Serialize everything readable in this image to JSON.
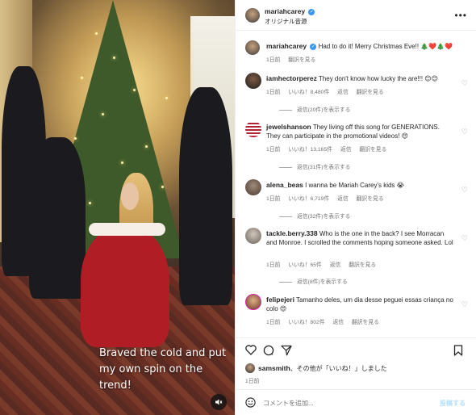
{
  "post": {
    "caption_video": "Braved the cold and put my own spin on the trend!"
  },
  "header": {
    "username": "mariahcarey",
    "audio": "オリジナル音源",
    "more": "•••"
  },
  "owner_comment": {
    "username": "mariahcarey",
    "text": "Had to do it! Merry Christmas Eve!! 🎄❤️🎄❤️",
    "age": "1日前",
    "translate": "翻訳を見る"
  },
  "comments": [
    {
      "username": "iamhectorperez",
      "text": "They don't know how lucky the are!!! 😊😊",
      "age": "1日前",
      "likes": "いいね！8,480件",
      "reply": "返信",
      "translate": "翻訳を見る",
      "replies": "返信(20件)を表示する"
    },
    {
      "username": "jewelshanson",
      "text": "They living off this song for GENERATIONS. They can participate in the promotional videos! 😍",
      "age": "1日前",
      "likes": "いいね！13,165件",
      "reply": "返信",
      "translate": "翻訳を見る",
      "replies": "返信(31件)を表示する"
    },
    {
      "username": "alena_beas",
      "text": "I wanna be Mariah Carey's kids 😭",
      "age": "1日前",
      "likes": "いいね！6,719件",
      "reply": "返信",
      "translate": "翻訳を見る",
      "replies": "返信(32件)を表示する"
    },
    {
      "username": "tackle.berry.338",
      "text": "Who is the one in the back? I see Morracan and Monroe. I scrolled the comments hoping someone asked. Lol",
      "age": "1日前",
      "likes": "いいね！65件",
      "reply": "返信",
      "translate": "翻訳を見る",
      "replies": "返信(8件)を表示する"
    },
    {
      "username": "felipejeri",
      "text": "Tamanho deles, um dia desse peguei essas criança no colo 😍",
      "age": "1日前",
      "likes": "いいね！802件",
      "reply": "返信",
      "translate": "翻訳を見る",
      "replies": ""
    }
  ],
  "liked_by": {
    "username": "samsmith",
    "rest": "、その他が「いいね！」しました"
  },
  "post_date": "1日前",
  "composer": {
    "placeholder": "コメントを追加...",
    "post_label": "投稿する"
  },
  "icons": {
    "heart": "heart-icon",
    "comment": "comment-icon",
    "share": "share-icon",
    "bookmark": "bookmark-icon",
    "emoji": "emoji-icon",
    "mute": "mute-icon"
  }
}
